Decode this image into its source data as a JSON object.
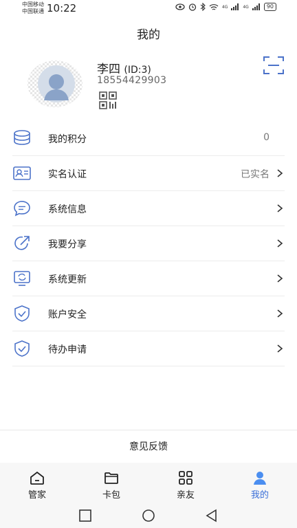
{
  "status_bar": {
    "carrier_1": "中国移动",
    "carrier_2": "中国联通",
    "time": "10:22",
    "network_1": "4G",
    "network_2": "4G",
    "battery": "90"
  },
  "page_title": "我的",
  "profile": {
    "name": "李四",
    "id_text": "(ID:3)",
    "phone": "18554429903"
  },
  "menu": [
    {
      "label": "我的积分",
      "value": "0",
      "icon": "coin-stack-icon",
      "has_chevron": false
    },
    {
      "label": "实名认证",
      "value": "已实名",
      "icon": "id-card-icon",
      "has_chevron": true
    },
    {
      "label": "系统信息",
      "value": "",
      "icon": "chat-bubble-icon",
      "has_chevron": true
    },
    {
      "label": "我要分享",
      "value": "",
      "icon": "share-icon",
      "has_chevron": true
    },
    {
      "label": "系统更新",
      "value": "",
      "icon": "update-monitor-icon",
      "has_chevron": true
    },
    {
      "label": "账户安全",
      "value": "",
      "icon": "shield-check-icon",
      "has_chevron": true
    },
    {
      "label": "待办申请",
      "value": "",
      "icon": "shield-check-icon",
      "has_chevron": true
    }
  ],
  "feedback_label": "意见反馈",
  "tabs": [
    {
      "label": "管家",
      "icon": "home-icon"
    },
    {
      "label": "卡包",
      "icon": "folder-icon"
    },
    {
      "label": "亲友",
      "icon": "grid-apps-icon"
    },
    {
      "label": "我的",
      "icon": "user-icon"
    }
  ],
  "colors": {
    "accent": "#3a6fd8",
    "icon_blue": "#4b72c9",
    "text": "#222222",
    "muted": "#777777"
  }
}
